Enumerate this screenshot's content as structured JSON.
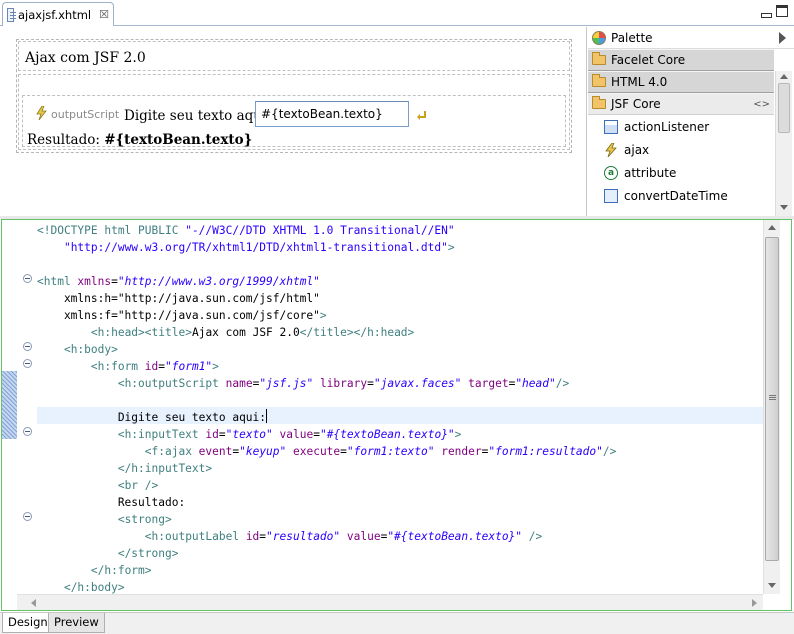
{
  "editor_tab": {
    "label": "ajaxjsf.xhtml",
    "close": "☒"
  },
  "design": {
    "page_title": "Ajax com JSF 2.0",
    "output_script_label": "outputScript",
    "prompt": "Digite seu texto aqui:",
    "input_value": "#{textoBean.texto}",
    "result_label": "Resultado: ",
    "result_value": "#{textoBean.texto}"
  },
  "palette": {
    "title": "Palette",
    "drawers": [
      {
        "label": "Facelet Core"
      },
      {
        "label": "HTML 4.0"
      },
      {
        "label": "JSF Core"
      }
    ],
    "items": [
      {
        "label": "actionListener",
        "icon": "action-listener-icon"
      },
      {
        "label": "ajax",
        "icon": "ajax-icon"
      },
      {
        "label": "attribute",
        "icon": "attribute-icon"
      },
      {
        "label": "convertDateTime",
        "icon": "convert-datetime-icon"
      }
    ]
  },
  "source": {
    "highlight_color": "#e8f2fe",
    "lines": [
      "<!DOCTYPE html PUBLIC \"-//W3C//DTD XHTML 1.0 Transitional//EN\"",
      "    \"http://www.w3.org/TR/xhtml1/DTD/xhtml1-transitional.dtd\">",
      "",
      "<html xmlns=\"http://www.w3.org/1999/xhtml\"",
      "    xmlns:h=\"http://java.sun.com/jsf/html\"",
      "    xmlns:f=\"http://java.sun.com/jsf/core\">",
      "        <h:head><title>Ajax com JSF 2.0</title></h:head>",
      "    <h:body>",
      "        <h:form id=\"form1\">",
      "            <h:outputScript name=\"jsf.js\" library=\"javax.faces\" target=\"head\"/>",
      "",
      "            Digite seu texto aqui:",
      "            <h:inputText id=\"texto\" value=\"#{textoBean.texto}\">",
      "                <f:ajax event=\"keyup\" execute=\"form1:texto\" render=\"form1:resultado\"/>",
      "            </h:inputText>",
      "            <br />",
      "            Resultado:",
      "            <strong>",
      "                <h:outputLabel id=\"resultado\" value=\"#{textoBean.texto}\" />",
      "            </strong>",
      "        </h:form>",
      "    </h:body>"
    ]
  },
  "bottom_tabs": [
    {
      "label": "Design",
      "active": true
    },
    {
      "label": "Preview",
      "active": false
    }
  ]
}
